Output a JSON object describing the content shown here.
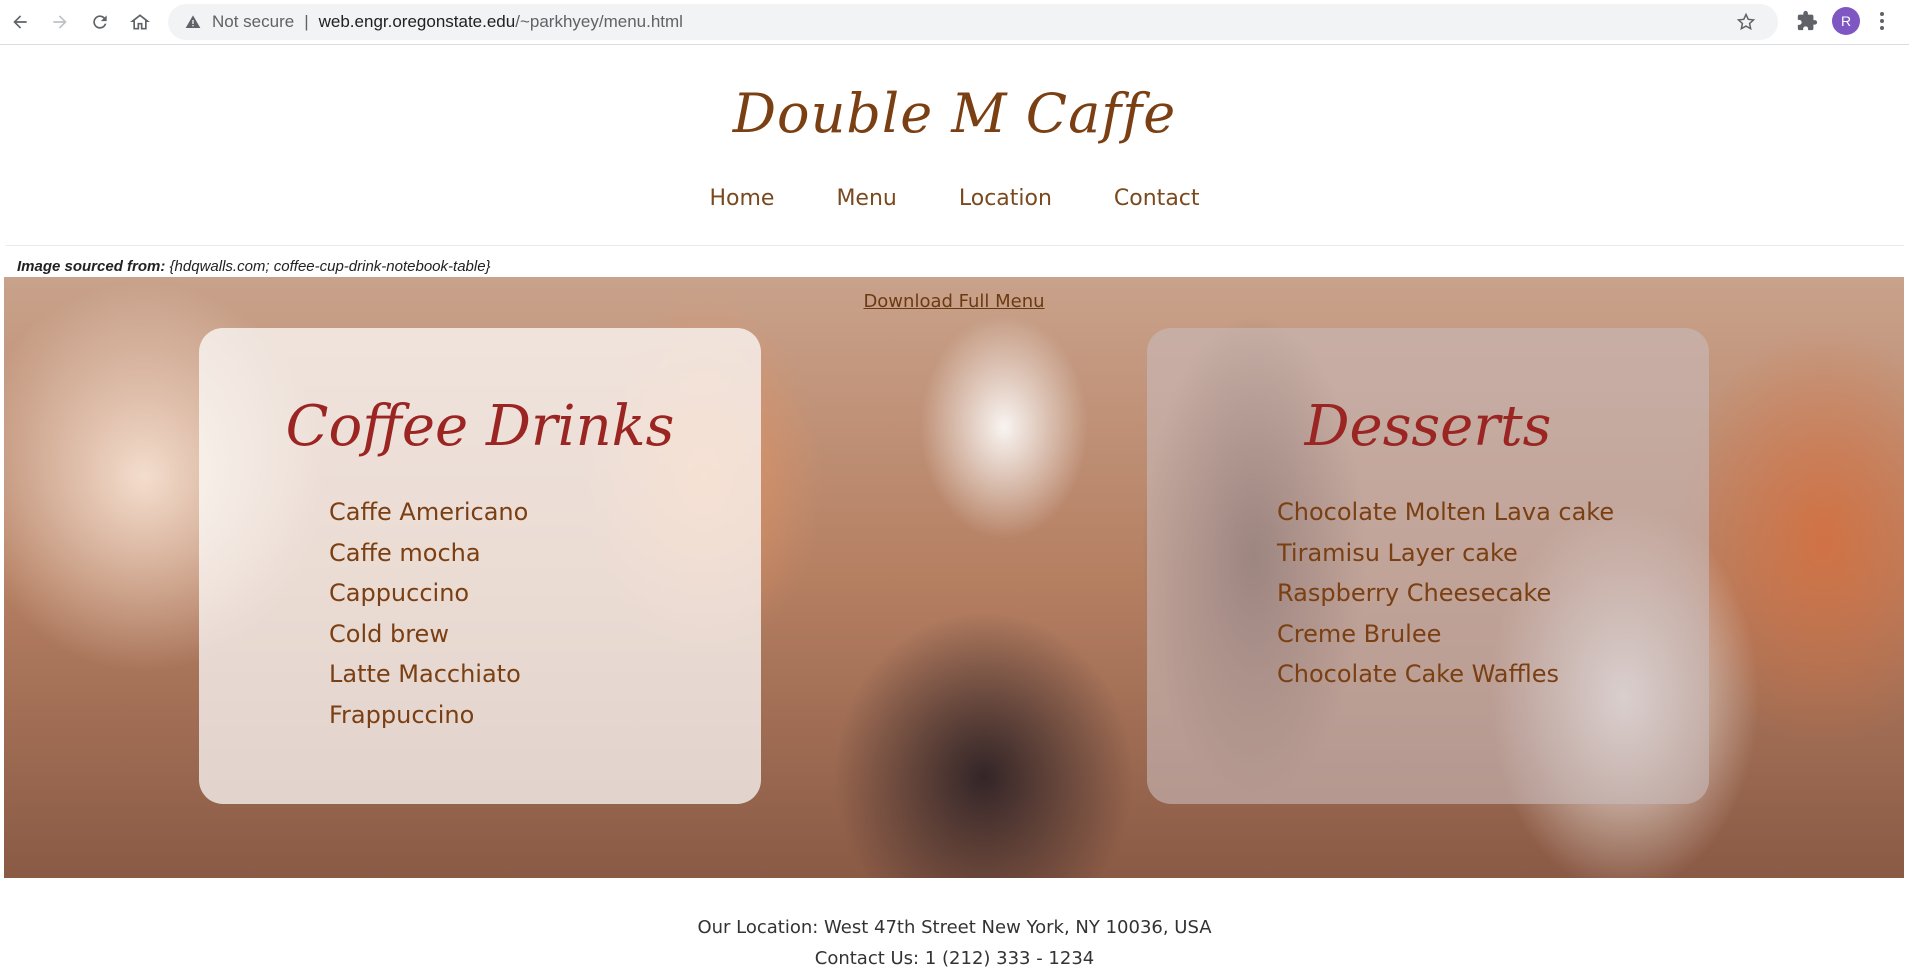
{
  "browser": {
    "security_label": "Not secure",
    "separator": "|",
    "url_host": "web.engr.oregonstate.edu",
    "url_path": "/~parkhyey/menu.html",
    "avatar_letter": "R",
    "icons": [
      "back-icon",
      "forward-icon",
      "reload-icon",
      "home-icon",
      "warning-icon",
      "star-icon",
      "puzzle-icon",
      "kebab-menu-icon"
    ]
  },
  "site": {
    "title": "Double M Caffe",
    "nav": [
      "Home",
      "Menu",
      "Location",
      "Contact"
    ]
  },
  "credit": {
    "label": "Image sourced from:",
    "source": "{hdqwalls.com; coffee-cup-drink-notebook-table}"
  },
  "menu": {
    "download_label": "Download Full Menu",
    "coffee": {
      "title": "Coffee Drinks",
      "items": [
        "Caffe Americano",
        "Caffe mocha",
        "Cappuccino",
        "Cold brew",
        "Latte Macchiato",
        "Frappuccino"
      ]
    },
    "desserts": {
      "title": "Desserts",
      "items": [
        "Chocolate Molten Lava cake",
        "Tiramisu Layer cake",
        "Raspberry Cheesecake",
        "Creme Brulee",
        "Chocolate Cake Waffles"
      ]
    }
  },
  "footer": {
    "location": "Our Location: West 47th Street New York, NY 10036, USA",
    "contact": "Contact Us: 1 (212) 333 - 1234"
  },
  "colors": {
    "title": "#7a3f12",
    "card_heading": "#9b2522",
    "menu_item": "#7a3f12",
    "avatar": "#7e57c2"
  }
}
